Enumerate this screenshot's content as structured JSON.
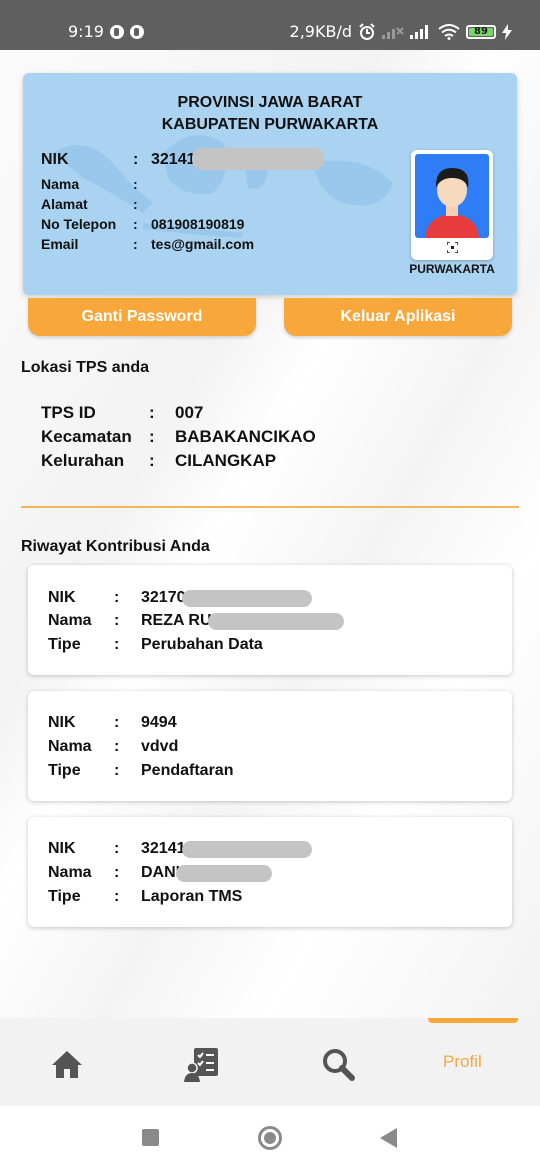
{
  "status_bar": {
    "time": "9:19",
    "network_speed": "2,9KB/d",
    "battery_level": "89",
    "icons": [
      "notification-icon",
      "notification-icon",
      "alarm-icon",
      "signal-icon",
      "signal-icon",
      "wifi-icon",
      "battery-icon",
      "charging-icon"
    ]
  },
  "id_card": {
    "province": "PROVINSI JAWA BARAT",
    "regency": "KABUPATEN PURWAKARTA",
    "fields": [
      {
        "label": "NIK",
        "value": "32141"
      },
      {
        "label": "Nama",
        "value": ""
      },
      {
        "label": "Alamat",
        "value": ""
      },
      {
        "label": "No Telepon",
        "value": "081908190819"
      },
      {
        "label": "Email",
        "value": "tes@gmail.com"
      }
    ],
    "photo_caption": "PURWAKARTA"
  },
  "actions": {
    "change_password": "Ganti Password",
    "logout": "Keluar Aplikasi"
  },
  "tps": {
    "title": "Lokasi TPS anda",
    "rows": [
      {
        "label": "TPS ID",
        "value": "007"
      },
      {
        "label": "Kecamatan",
        "value": "BABAKANCIKAO"
      },
      {
        "label": "Kelurahan",
        "value": "CILANGKAP"
      }
    ]
  },
  "history": {
    "title": "Riwayat Kontribusi Anda",
    "labels": {
      "nik": "NIK",
      "nama": "Nama",
      "tipe": "Tipe"
    },
    "items": [
      {
        "nik": "32170",
        "nama": "REZA RU",
        "tipe": "Perubahan Data"
      },
      {
        "nik": "9494",
        "nama": "vdvd",
        "tipe": "Pendaftaran"
      },
      {
        "nik": "32141",
        "nama": "DANI",
        "tipe": "Laporan TMS"
      }
    ]
  },
  "bottom_nav": {
    "items": [
      {
        "icon": "home-icon"
      },
      {
        "icon": "report-list-icon"
      },
      {
        "icon": "search-icon"
      },
      {
        "label": "Profil"
      }
    ],
    "accent_color": "#f8a83a"
  },
  "colors": {
    "card_blue": "#a9d3f1",
    "accent_orange": "#f8a83a"
  }
}
